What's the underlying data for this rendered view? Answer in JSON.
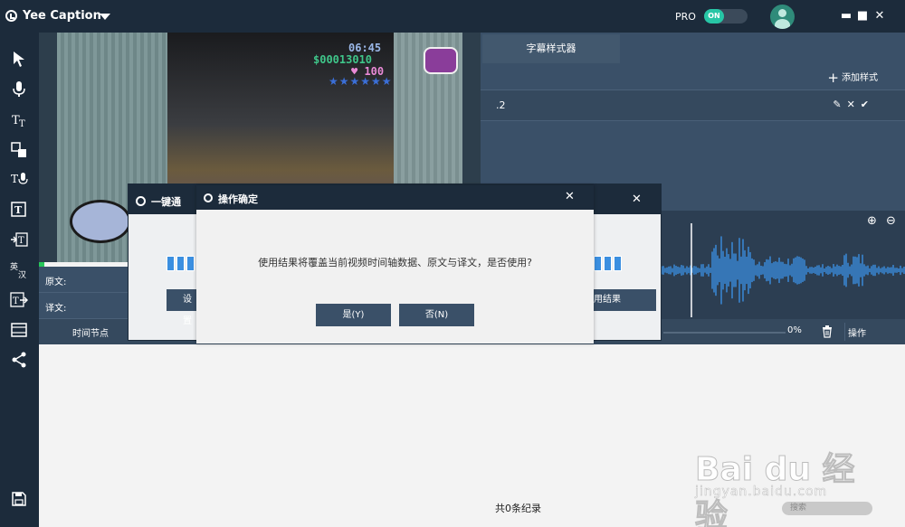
{
  "app": {
    "title": "Yee Caption",
    "pro_label": "PRO",
    "toggle_label": "ON"
  },
  "window": {
    "minimize": "▬",
    "maximize": "■",
    "close": "✕"
  },
  "hud": {
    "time": "06:45",
    "money": "$00013010",
    "health": "♥ 100",
    "stars": "★★★★★★"
  },
  "style_panel": {
    "tab": "字幕样式器",
    "add_label": "添加样式",
    "rows": [
      {
        "name": ".2"
      }
    ]
  },
  "text_rows": {
    "original_label": "原文:",
    "translation_label": "译文:"
  },
  "table": {
    "time_col": "时间节点",
    "percent": "0%",
    "ops_col": "操作"
  },
  "footer": {
    "record_count": "共0条纪录",
    "search_placeholder": "搜索"
  },
  "dialog_back": {
    "title": "一键通",
    "left_btn": "设置",
    "right_btn": "用结果"
  },
  "dialog_front": {
    "title": "操作确定",
    "message": "使用结果将覆盖当前视频时间轴数据、原文与译文，是否使用?",
    "yes_label": "是(Y)",
    "no_label": "否(N)"
  },
  "watermark": {
    "main": "Bai du 经验",
    "sub": "jingyan.baidu.com"
  },
  "colors": {
    "accent": "#27c6a6",
    "panel": "#3a5068",
    "dark": "#1c2b3b",
    "wave": "#3b8fe0"
  }
}
